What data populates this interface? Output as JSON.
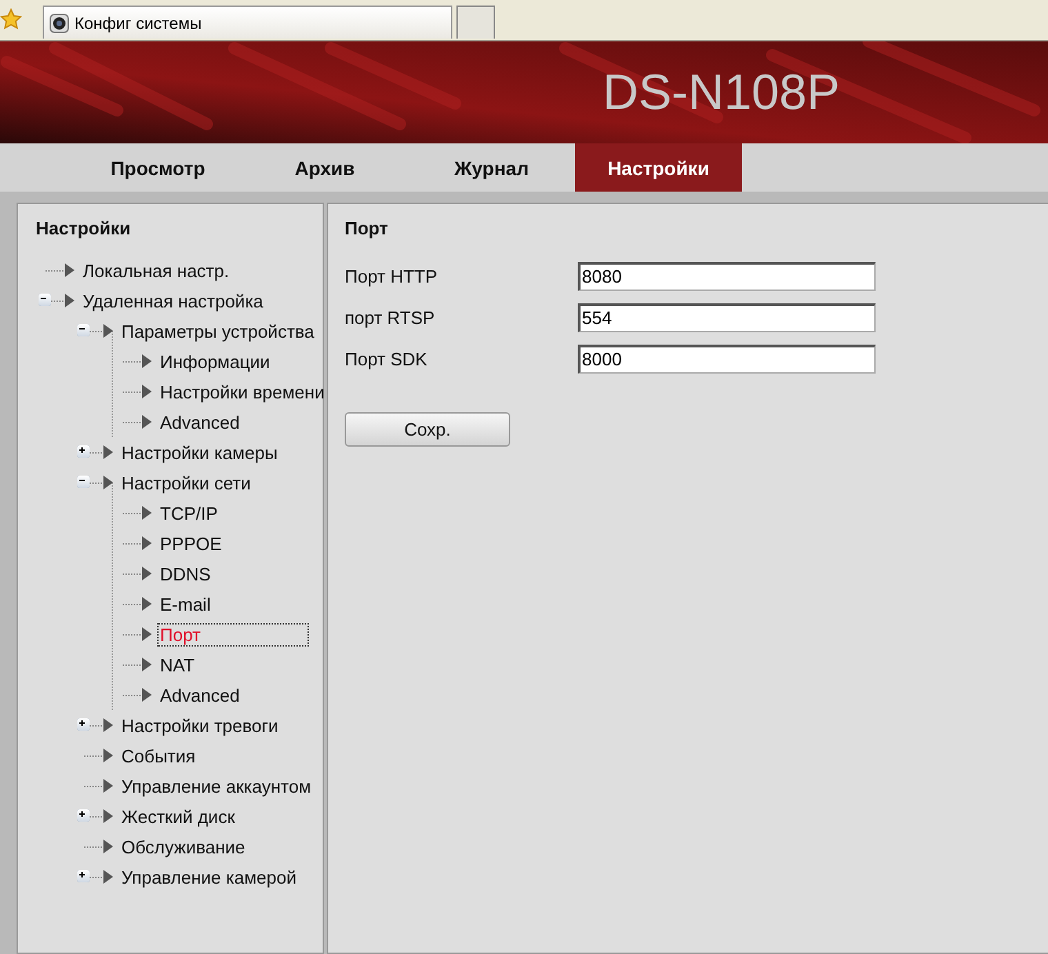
{
  "browser_tab": {
    "title": "Конфиг системы"
  },
  "header": {
    "model": "DS-N108P"
  },
  "nav_tabs": [
    {
      "label": "Просмотр",
      "selected": false
    },
    {
      "label": "Архив",
      "selected": false
    },
    {
      "label": "Журнал",
      "selected": false
    },
    {
      "label": "Настройки",
      "selected": true
    }
  ],
  "sidebar": {
    "title": "Настройки",
    "items": [
      {
        "label": "Локальная настр.",
        "selected": false
      },
      {
        "label": "Удаленная настройка",
        "selected": false,
        "expanded": true,
        "children": [
          {
            "label": "Параметры устройства",
            "selected": false,
            "expanded": true,
            "children": [
              {
                "label": "Информации",
                "selected": false
              },
              {
                "label": "Настройки времени",
                "selected": false
              },
              {
                "label": "Advanced",
                "selected": false
              }
            ]
          },
          {
            "label": "Настройки камеры",
            "selected": false,
            "expanded": false
          },
          {
            "label": "Настройки сети",
            "selected": false,
            "expanded": true,
            "children": [
              {
                "label": "TCP/IP",
                "selected": false
              },
              {
                "label": "PPPOE",
                "selected": false
              },
              {
                "label": "DDNS",
                "selected": false
              },
              {
                "label": "E-mail",
                "selected": false
              },
              {
                "label": "Порт",
                "selected": true
              },
              {
                "label": "NAT",
                "selected": false
              },
              {
                "label": "Advanced",
                "selected": false
              }
            ]
          },
          {
            "label": "Настройки тревоги",
            "selected": false,
            "expanded": false
          },
          {
            "label": "События",
            "selected": false
          },
          {
            "label": "Управление аккаунтом",
            "selected": false
          },
          {
            "label": "Жесткий диск",
            "selected": false,
            "expanded": false
          },
          {
            "label": "Обслуживание",
            "selected": false
          },
          {
            "label": "Управление камерой",
            "selected": false,
            "expanded": false
          }
        ]
      }
    ]
  },
  "content": {
    "title": "Порт",
    "fields": [
      {
        "label": "Порт HTTP",
        "value": "8080"
      },
      {
        "label": "порт RTSP",
        "value": "554"
      },
      {
        "label": "Порт SDK",
        "value": "8000"
      }
    ],
    "save_button": "Сохр."
  }
}
